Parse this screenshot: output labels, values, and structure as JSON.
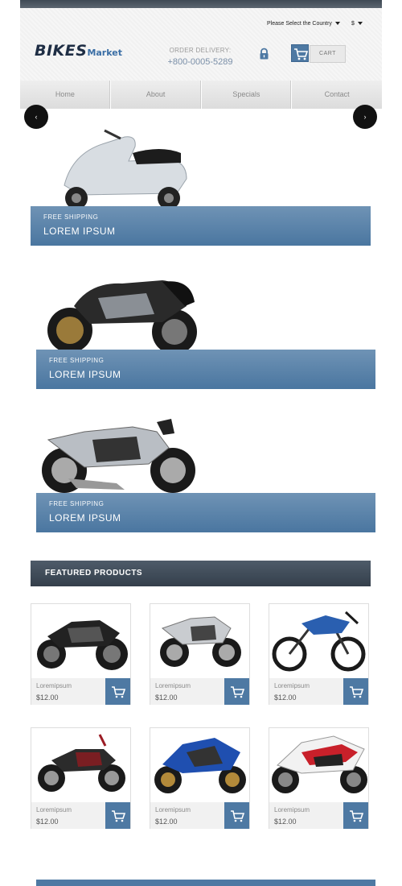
{
  "header": {
    "country_select": "Please Select the Country",
    "currency": "$",
    "logo_main": "BIKES",
    "logo_sub": "Market",
    "order_label": "ORDER DELIVERY:",
    "phone": "+800-0005-5289",
    "cart_label": "CART"
  },
  "nav": {
    "items": [
      "Home",
      "About",
      "Specials",
      "Contact"
    ]
  },
  "slider": {
    "prev": "‹",
    "next": "›",
    "slides": [
      {
        "sub": "FREE SHIPPING",
        "title": "LOREM IPSUM"
      },
      {
        "sub": "FREE SHIPPING",
        "title": "LOREM IPSUM"
      },
      {
        "sub": "FREE SHIPPING",
        "title": "LOREM IPSUM"
      }
    ]
  },
  "featured": {
    "heading": "FEATURED PRODUCTS",
    "products": [
      {
        "name": "Loremipsum",
        "price": "$12.00"
      },
      {
        "name": "Loremipsum",
        "price": "$12.00"
      },
      {
        "name": "Loremipsum",
        "price": "$12.00"
      },
      {
        "name": "Loremipsum",
        "price": "$12.00"
      },
      {
        "name": "Loremipsum",
        "price": "$12.00"
      },
      {
        "name": "Loremipsum",
        "price": "$12.00"
      }
    ]
  },
  "colors": {
    "accent_blue": "#4e79a3",
    "dark_header": "#3f4a55",
    "logo_navy": "#1e2d44"
  }
}
